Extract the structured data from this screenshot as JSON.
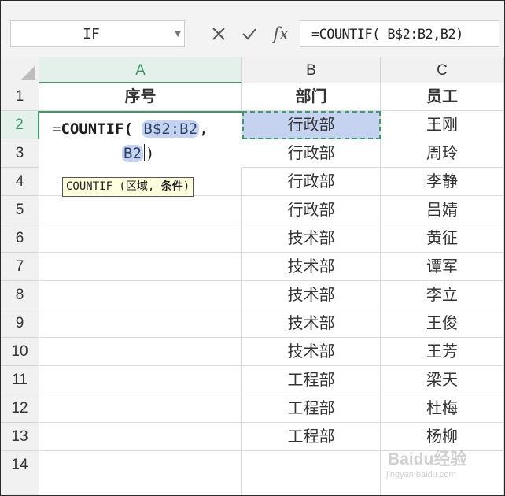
{
  "formula_bar": {
    "name_box": "IF",
    "cancel_icon": "close-icon",
    "confirm_icon": "check-icon",
    "fx_label": "fx",
    "formula": "=COUNTIF( B$2:B2,B2)"
  },
  "sheet": {
    "columns": [
      "A",
      "B",
      "C"
    ],
    "rows": [
      "1",
      "2",
      "3",
      "4",
      "5",
      "6",
      "7",
      "8",
      "9",
      "10",
      "11",
      "12",
      "13",
      "14"
    ],
    "active_cell": "A2",
    "reference_cell": "B2",
    "headers": {
      "a": "序号",
      "b": "部门",
      "c": "员工"
    },
    "data_rows": [
      {
        "b": "行政部",
        "c": "王刚"
      },
      {
        "b": "行政部",
        "c": "周玲"
      },
      {
        "b": "行政部",
        "c": "李静"
      },
      {
        "b": "行政部",
        "c": "吕婧"
      },
      {
        "b": "技术部",
        "c": "黄征"
      },
      {
        "b": "技术部",
        "c": "谭军"
      },
      {
        "b": "技术部",
        "c": "李立"
      },
      {
        "b": "技术部",
        "c": "王俊"
      },
      {
        "b": "技术部",
        "c": "王芳"
      },
      {
        "b": "工程部",
        "c": "梁天"
      },
      {
        "b": "工程部",
        "c": "杜梅"
      },
      {
        "b": "工程部",
        "c": "杨柳"
      }
    ]
  },
  "editor": {
    "prefix": "=",
    "function": "COUNTIF(",
    "range_ref": "B$2:B2",
    "comma": ",",
    "criteria_ref": "B2",
    "close": ")"
  },
  "tooltip": {
    "signature": "COUNTIF (区域, ",
    "active_arg": "条件",
    "close": ")"
  },
  "watermark": {
    "text": "Baidu经验",
    "sub": "jingyan.baidu.com"
  },
  "colors": {
    "active_accent": "#3e9b67",
    "reference_fill": "#c5d3f1",
    "tooltip_bg": "#ffffde"
  }
}
